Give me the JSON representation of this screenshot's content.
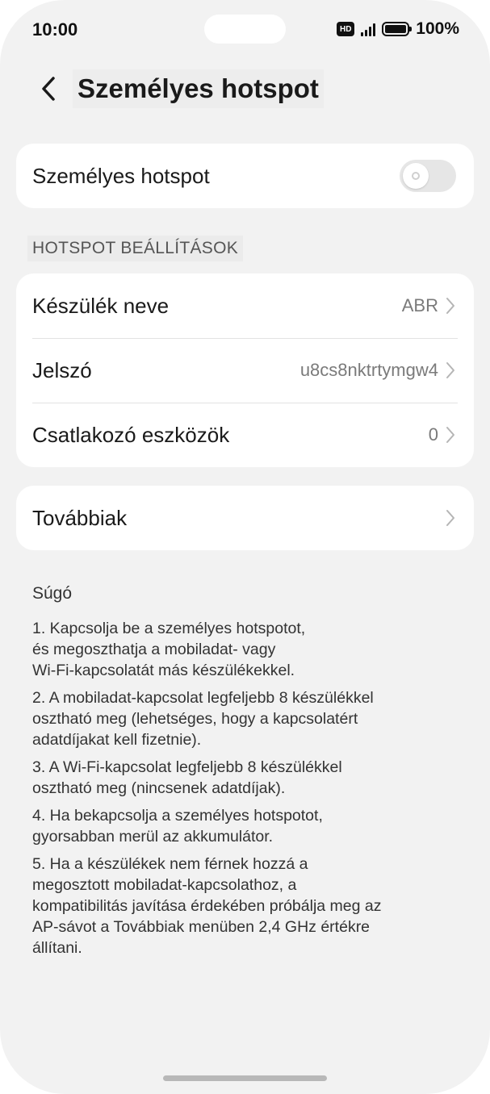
{
  "status_bar": {
    "time": "10:00",
    "hd_label": "HD",
    "battery": "100%"
  },
  "header": {
    "back_icon": "chevron-left-icon",
    "title": "Személyes hotspot"
  },
  "hotspot_toggle": {
    "label": "Személyes hotspot",
    "enabled": false
  },
  "section": {
    "title": "HOTSPOT BEÁLLÍTÁSOK"
  },
  "settings": [
    {
      "label": "Készülék neve",
      "value": "ABR"
    },
    {
      "label": "Jelszó",
      "value": "u8cs8nktrtymgw4"
    },
    {
      "label": "Csatlakozó eszközök",
      "value": "0"
    }
  ],
  "more": {
    "label": "Továbbiak"
  },
  "help": {
    "title": "Súgó",
    "items": [
      "1. Kapcsolja be a személyes hotspotot,\nés megoszthatja a mobiladat- vagy\nWi-Fi-kapcsolatát más készülékekkel.",
      "2. A mobiladat-kapcsolat legfeljebb 8 készülékkel\nosztható meg (lehetséges, hogy a kapcsolatért\nadatdíjakat kell fizetnie).",
      "3. A Wi-Fi-kapcsolat legfeljebb 8 készülékkel\nosztható meg (nincsenek adatdíjak).",
      "4. Ha bekapcsolja a személyes hotspotot,\ngyorsabban merül az akkumulátor.",
      "5. Ha a készülékek nem férnek hozzá a\nmegosztott mobiladat-kapcsolathoz, a\nkompatibilitás javítása érdekében próbálja meg az\nAP-sávot a Továbbiak menüben 2,4 GHz értékre\nállítani."
    ]
  }
}
